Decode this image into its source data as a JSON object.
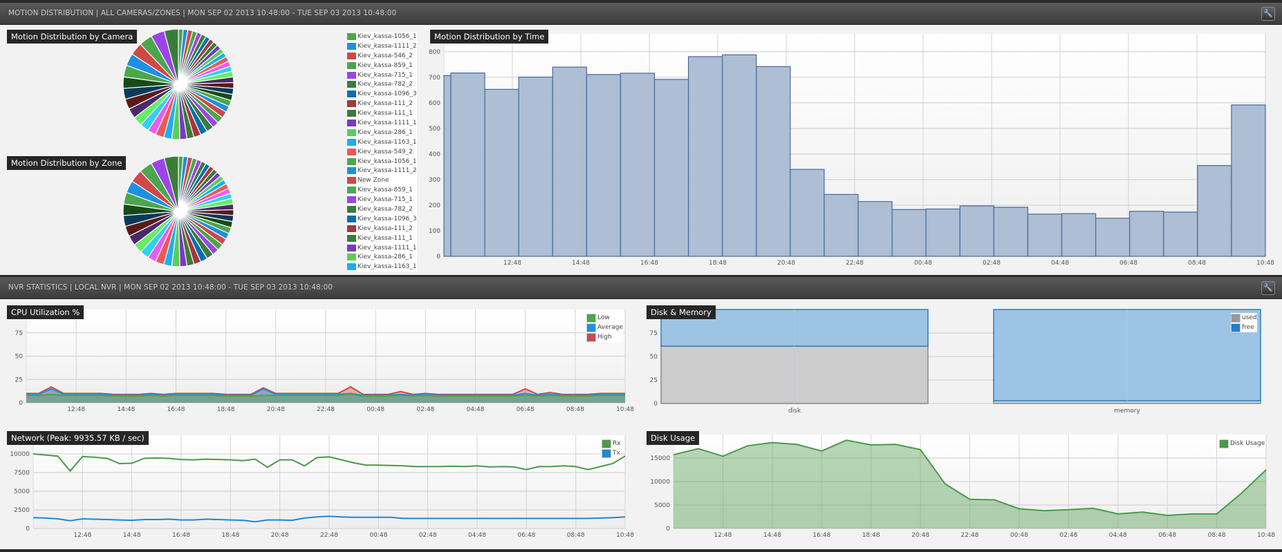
{
  "motion_panel": {
    "header": "MOTION DISTRIBUTION | ALL CAMERAS/ZONES | MON SEP 02 2013 10:48:00 - TUE SEP 03 2013 10:48:00",
    "settings_icon": "wrench-icon"
  },
  "nvr_panel": {
    "header": "NVR STATISTICS | LOCAL NVR | MON SEP 02 2013 10:48:00 - TUE SEP 03 2013 10:48:00",
    "settings_icon": "wrench-icon"
  },
  "pie_legend": [
    {
      "label": "Kiev_kassa-1056_1",
      "color": "#4ca64c"
    },
    {
      "label": "Kiev_kassa-1111_2",
      "color": "#1e90e0"
    },
    {
      "label": "Kiev_kassa-546_2",
      "color": "#d04848"
    },
    {
      "label": "Kiev_kassa-859_1",
      "color": "#4ca64c"
    },
    {
      "label": "Kiev_kassa-715_1",
      "color": "#9b45e8"
    },
    {
      "label": "Kiev_kassa-782_2",
      "color": "#3a7d3a"
    },
    {
      "label": "Kiev_kassa-1096_3",
      "color": "#0b6eb0"
    },
    {
      "label": "Kiev_kassa-111_2",
      "color": "#a33a3a"
    },
    {
      "label": "Kiev_kassa-111_1",
      "color": "#3a7d3a"
    },
    {
      "label": "Kiev_kassa-1111_1",
      "color": "#7a3ac0"
    },
    {
      "label": "Kiev_kassa-286_1",
      "color": "#5ccc5c"
    },
    {
      "label": "Kiev_kassa-1163_1",
      "color": "#1ab0f0"
    },
    {
      "label": "Kiev_kassa-549_2",
      "color": "#f05858"
    },
    {
      "label": "Kiev_kassa-1056_1",
      "color": "#4ca64c"
    },
    {
      "label": "Kiev_kassa-1111_2",
      "color": "#1e90e0"
    },
    {
      "label": "New Zone",
      "color": "#d04848"
    },
    {
      "label": "Kiev_kassa-859_1",
      "color": "#4ca64c"
    },
    {
      "label": "Kiev_kassa-715_1",
      "color": "#9b45e8"
    },
    {
      "label": "Kiev_kassa-782_2",
      "color": "#3a7d3a"
    },
    {
      "label": "Kiev_kassa-1096_3",
      "color": "#0b6eb0"
    },
    {
      "label": "Kiev_kassa-111_2",
      "color": "#a33a3a"
    },
    {
      "label": "Kiev_kassa-111_1",
      "color": "#3a7d3a"
    },
    {
      "label": "Kiev_kassa-1111_1",
      "color": "#7a3ac0"
    },
    {
      "label": "Kiev_kassa-286_1",
      "color": "#5ccc5c"
    },
    {
      "label": "Kiev_kassa-1163_1",
      "color": "#1ab0f0"
    }
  ],
  "chart_data": [
    {
      "type": "pie",
      "title": "Motion Distribution by Camera",
      "colors": [
        "#4ca64c",
        "#1e90e0",
        "#d04848",
        "#4ca64c",
        "#9b45e8",
        "#3a7d3a",
        "#0b6eb0",
        "#a33a3a",
        "#3a7d3a",
        "#7a3ac0",
        "#5ccc5c",
        "#1ab0f0",
        "#f05858",
        "#e85ef0",
        "#2fd0f0",
        "#66ee66",
        "#4a2a6a",
        "#5a1a1a",
        "#0a3a5a",
        "#1a4a1a"
      ],
      "values": [
        2,
        2,
        2,
        2,
        2,
        2,
        2,
        2,
        2,
        2,
        2,
        2,
        2.2,
        2.2,
        2.2,
        2.4,
        2.4,
        2.4,
        2.6,
        2.6,
        2.6,
        2.6,
        2.8,
        2.8,
        2.8,
        3,
        3,
        3,
        3,
        3,
        3.4,
        3.4,
        3.6,
        3.6,
        3.8,
        4,
        4.2,
        4.4,
        4.6,
        4.8,
        5,
        5.2,
        5.4,
        5.6,
        5.8,
        6
      ]
    },
    {
      "type": "pie",
      "title": "Motion Distribution by Zone",
      "colors": [
        "#4ca64c",
        "#1e90e0",
        "#d04848",
        "#4ca64c",
        "#9b45e8",
        "#3a7d3a",
        "#0b6eb0",
        "#a33a3a",
        "#3a7d3a",
        "#7a3ac0",
        "#5ccc5c",
        "#1ab0f0",
        "#f05858",
        "#e85ef0",
        "#2fd0f0",
        "#66ee66",
        "#4a2a6a",
        "#5a1a1a",
        "#0a3a5a",
        "#1a4a1a"
      ],
      "values": [
        2,
        2,
        2,
        2,
        2,
        2,
        2,
        2,
        2,
        2,
        2,
        2,
        2.2,
        2.2,
        2.2,
        2.4,
        2.4,
        2.4,
        2.6,
        2.6,
        2.6,
        2.6,
        2.8,
        2.8,
        2.8,
        3,
        3,
        3,
        3,
        3,
        3.4,
        3.4,
        3.6,
        3.6,
        3.8,
        4,
        4.2,
        4.4,
        4.6,
        4.8,
        5,
        5.2,
        5.4,
        5.6,
        5.8,
        6
      ]
    },
    {
      "type": "bar",
      "title": "Motion Distribution by Time",
      "values": [
        707,
        717,
        653,
        701,
        740,
        711,
        716,
        692,
        781,
        788,
        742,
        340,
        242,
        214,
        183,
        185,
        197,
        192,
        165,
        167,
        149,
        176,
        173,
        355,
        592
      ],
      "xticks": [
        "12:48",
        "14:48",
        "16:48",
        "18:48",
        "20:48",
        "22:48",
        "00:48",
        "02:48",
        "04:48",
        "06:48",
        "08:48",
        "10:48"
      ],
      "yticks": [
        "0",
        "100",
        "200",
        "300",
        "400",
        "500",
        "600",
        "700",
        "800"
      ],
      "ylim": [
        0,
        870
      ],
      "grid": true,
      "color": "#a9bad3",
      "edge": "#4a6a94"
    },
    {
      "type": "area",
      "title": "CPU Utilization %",
      "xticks": [
        "12:48",
        "14:48",
        "16:48",
        "18:48",
        "20:48",
        "22:48",
        "00:48",
        "02:48",
        "04:48",
        "06:48",
        "08:48",
        "10:48"
      ],
      "yticks": [
        "0",
        "25",
        "50",
        "75"
      ],
      "ylim": [
        0,
        100
      ],
      "legend": "top-right",
      "grid": true,
      "series": [
        {
          "name": "High",
          "color": "#d04848",
          "values": [
            10,
            10,
            17,
            10,
            10,
            10,
            10,
            9,
            9,
            9,
            10,
            9,
            10,
            10,
            10,
            10,
            9,
            9,
            9,
            16,
            10,
            10,
            10,
            10,
            10,
            10,
            17,
            9,
            9,
            9,
            12,
            9,
            10,
            9,
            9,
            9,
            9,
            9,
            9,
            9,
            15,
            9,
            11,
            9,
            9,
            9,
            10,
            10,
            10
          ]
        },
        {
          "name": "Average",
          "color": "#1e90e0",
          "values": [
            9,
            9,
            15,
            9,
            9,
            9,
            9,
            8,
            8,
            8,
            9,
            8,
            9,
            9,
            9,
            9,
            8,
            8,
            8,
            15,
            9,
            9,
            9,
            9,
            9,
            9,
            10,
            8,
            8,
            8,
            9,
            8,
            9,
            8,
            8,
            8,
            8,
            8,
            8,
            8,
            10,
            8,
            9,
            8,
            8,
            8,
            9,
            9,
            9
          ]
        },
        {
          "name": "Low",
          "color": "#4ca64c",
          "values": [
            8,
            8,
            9,
            8,
            8,
            8,
            8,
            7,
            7,
            7,
            8,
            7,
            8,
            8,
            8,
            8,
            7,
            7,
            7,
            8,
            8,
            8,
            8,
            8,
            8,
            8,
            9,
            7,
            7,
            7,
            8,
            7,
            8,
            7,
            7,
            7,
            7,
            7,
            7,
            7,
            8,
            7,
            8,
            7,
            7,
            7,
            8,
            8,
            8
          ]
        }
      ]
    },
    {
      "type": "bar",
      "title": "Disk & Memory",
      "categories": [
        "disk",
        "memory"
      ],
      "yticks": [
        "0",
        "25",
        "50",
        "75"
      ],
      "ylim": [
        0,
        100
      ],
      "legend": "top-right",
      "stacked": true,
      "series": [
        {
          "name": "used",
          "color": "#999999",
          "values": [
            61,
            3
          ]
        },
        {
          "name": "free",
          "color": "#1e80d0",
          "values": [
            39,
            97
          ]
        }
      ]
    },
    {
      "type": "line",
      "title": "Network (Peak: 9935.57 KB / sec)",
      "xticks": [
        "12:48",
        "14:48",
        "16:48",
        "18:48",
        "20:48",
        "22:48",
        "00:48",
        "02:48",
        "04:48",
        "06:48",
        "08:48",
        "10:48"
      ],
      "yticks": [
        "0",
        "2500",
        "5000",
        "7500",
        "10000"
      ],
      "ylim": [
        0,
        12500
      ],
      "legend": "top-right",
      "grid": true,
      "series": [
        {
          "name": "Rx",
          "color": "#4a9a4a",
          "values": [
            10000,
            9850,
            9700,
            7700,
            9650,
            9550,
            9400,
            8700,
            8750,
            9400,
            9450,
            9400,
            9250,
            9200,
            9300,
            9250,
            9200,
            9100,
            9300,
            8200,
            9200,
            9200,
            8400,
            9500,
            9600,
            9200,
            8800,
            8500,
            8500,
            8450,
            8400,
            8300,
            8300,
            8300,
            8350,
            8300,
            8400,
            8250,
            8300,
            8250,
            7900,
            8300,
            8300,
            8400,
            8300,
            7900,
            8300,
            8700,
            9700
          ]
        },
        {
          "name": "Tx",
          "color": "#1e88d0",
          "values": [
            1450,
            1400,
            1300,
            1050,
            1300,
            1250,
            1200,
            1150,
            1100,
            1200,
            1200,
            1250,
            1150,
            1150,
            1250,
            1200,
            1150,
            1100,
            900,
            1150,
            1150,
            1100,
            1400,
            1550,
            1650,
            1550,
            1500,
            1500,
            1500,
            1500,
            1350,
            1350,
            1350,
            1350,
            1350,
            1350,
            1350,
            1350,
            1350,
            1350,
            1350,
            1350,
            1350,
            1350,
            1350,
            1350,
            1400,
            1450,
            1550
          ]
        }
      ]
    },
    {
      "type": "area",
      "title": "Disk Usage",
      "xticks": [
        "12:48",
        "14:48",
        "16:48",
        "18:48",
        "20:48",
        "22:48",
        "00:48",
        "02:48",
        "04:48",
        "06:48",
        "08:48",
        "10:48"
      ],
      "yticks": [
        "0",
        "5000",
        "10000",
        "15000"
      ],
      "ylim": [
        0,
        20000
      ],
      "legend": "top-right",
      "grid": true,
      "series": [
        {
          "name": "Disk Usage",
          "color": "#4a9a4a",
          "values": [
            15700,
            17000,
            15400,
            17600,
            18300,
            17900,
            16500,
            18800,
            17800,
            17900,
            16800,
            9500,
            6200,
            6100,
            4200,
            3800,
            4000,
            4300,
            3100,
            3500,
            2800,
            3100,
            3100,
            7500,
            12500
          ]
        }
      ]
    }
  ]
}
